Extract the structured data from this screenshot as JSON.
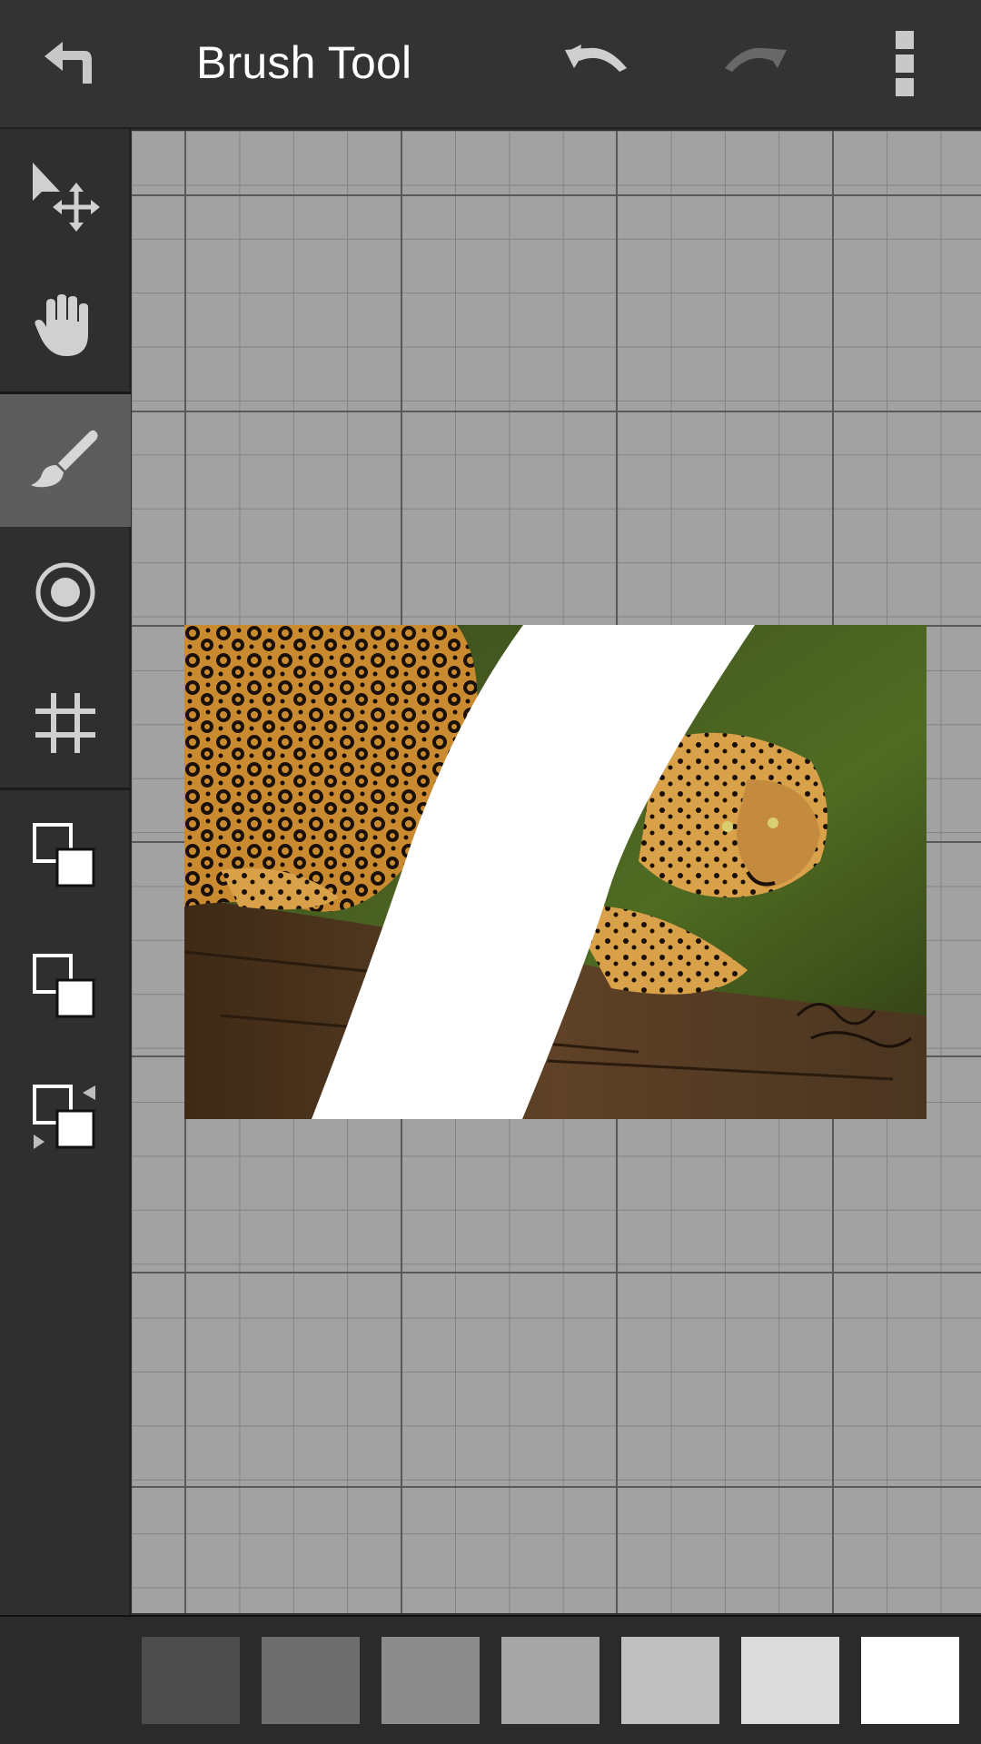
{
  "header": {
    "title": "Brush Tool",
    "back_icon": "back-arrow-icon",
    "undo_icon": "undo-icon",
    "redo_icon": "redo-icon",
    "menu_icon": "overflow-menu-icon"
  },
  "toolbar": {
    "tools": [
      {
        "name": "select-move",
        "icon": "select-move-icon",
        "active": false
      },
      {
        "name": "hand-pan",
        "icon": "hand-icon",
        "active": false
      },
      {
        "name": "brush",
        "icon": "brush-icon",
        "active": true
      },
      {
        "name": "radial",
        "icon": "target-circle-icon",
        "active": false
      },
      {
        "name": "grid",
        "icon": "grid-hash-icon",
        "active": false
      },
      {
        "name": "color-layer-1",
        "icon": "color-squares-icon",
        "active": false
      },
      {
        "name": "color-layer-2",
        "icon": "color-squares-icon",
        "active": false
      },
      {
        "name": "swap-colors",
        "icon": "swap-colors-icon",
        "active": false
      }
    ]
  },
  "palette": {
    "colors": [
      "#4d4d4d",
      "#6e6e6e",
      "#8c8c8c",
      "#a6a6a6",
      "#c0c0c0",
      "#dcdcdc",
      "#ffffff"
    ]
  },
  "colors": {
    "topbar": "#333333",
    "sidebar": "#2f2f2f",
    "active_tool": "#5d5d5d",
    "canvas": "#a2a2a2",
    "grid_line": "#838383"
  }
}
